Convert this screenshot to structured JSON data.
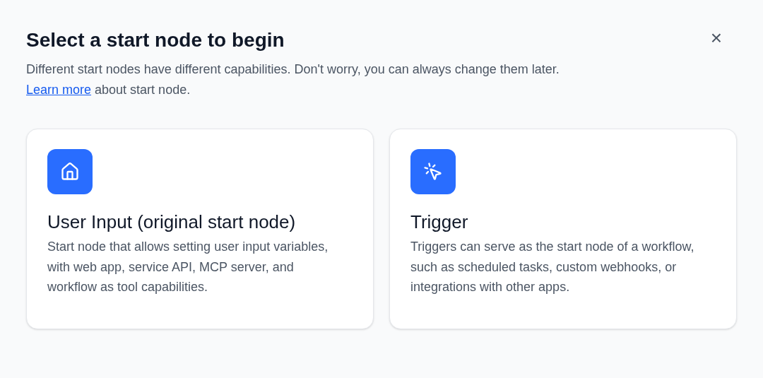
{
  "dialog": {
    "title": "Select a start node to begin",
    "close_label": "×",
    "description": "Different start nodes have different capabilities. Don't worry, you can always change them later.",
    "link": "Learn more",
    "after_link": " about start node."
  },
  "options": [
    {
      "kind": "user-input",
      "title": "User Input (original start node)",
      "description": "Start node that allows setting user input variables, with web app, service API, MCP server, and workflow as tool capabilities."
    },
    {
      "kind": "trigger",
      "title": "Trigger",
      "description": "Triggers can serve as the start node of a workflow, such as scheduled tasks, custom webhooks, or integrations with other apps."
    }
  ]
}
